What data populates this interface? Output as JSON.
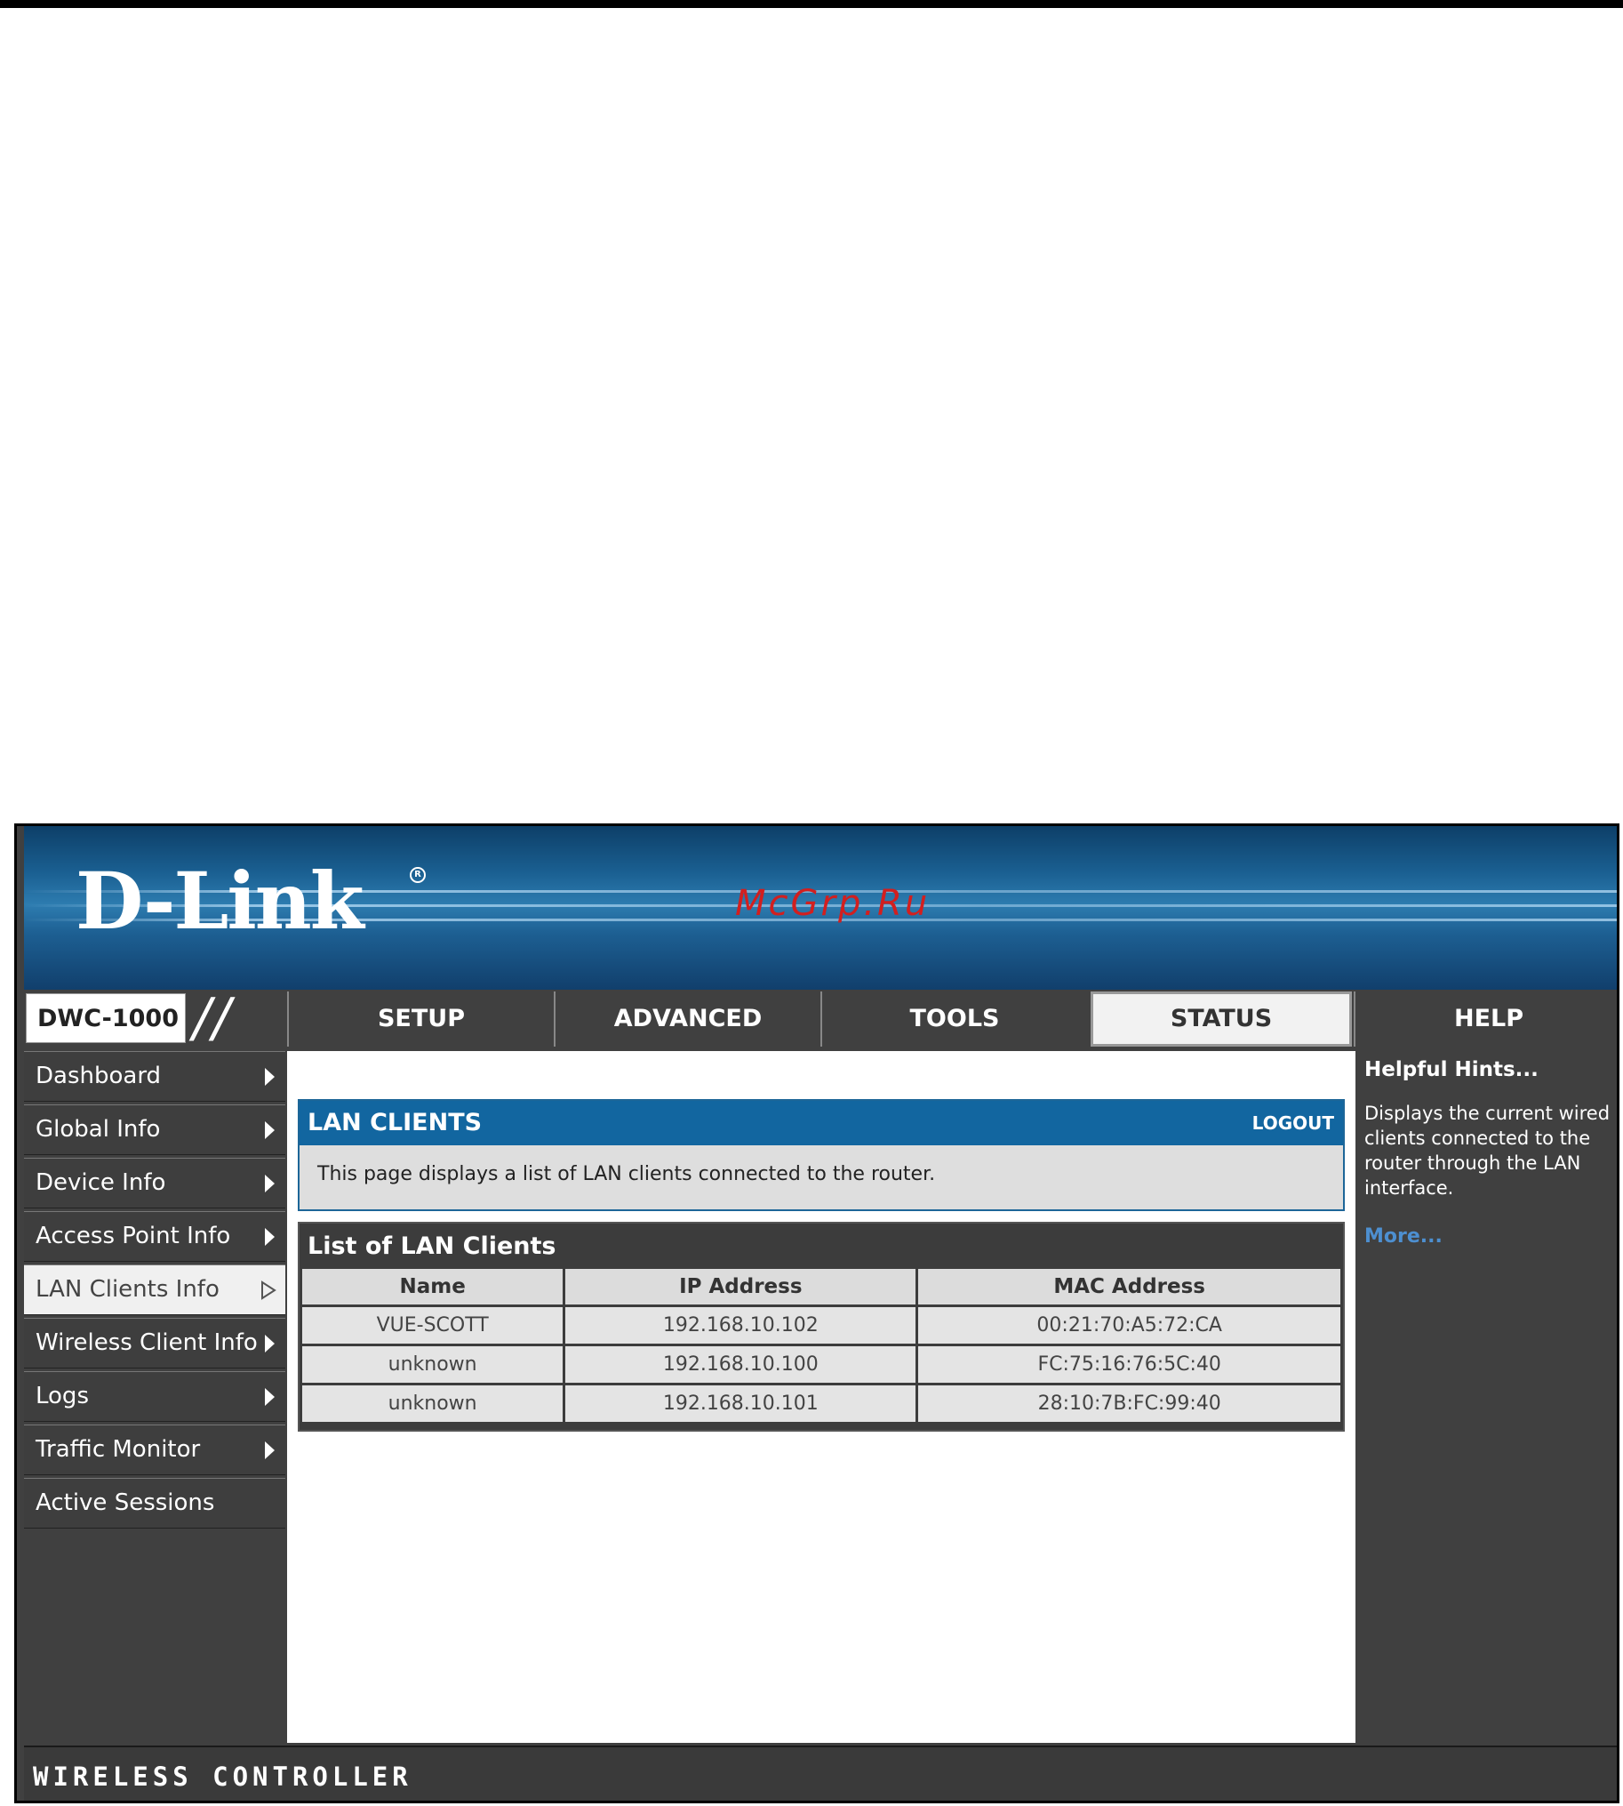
{
  "brand": {
    "logo": "D-Link",
    "watermark": "McGrp.Ru"
  },
  "nav": {
    "model": "DWC-1000",
    "tabs": [
      {
        "label": "SETUP"
      },
      {
        "label": "ADVANCED"
      },
      {
        "label": "TOOLS"
      },
      {
        "label": "STATUS",
        "active": true
      },
      {
        "label": "HELP"
      }
    ]
  },
  "sidebar": {
    "items": [
      {
        "label": "Dashboard"
      },
      {
        "label": "Global Info"
      },
      {
        "label": "Device Info"
      },
      {
        "label": "Access Point Info"
      },
      {
        "label": "LAN Clients Info",
        "active": true
      },
      {
        "label": "Wireless Client Info"
      },
      {
        "label": "Logs"
      },
      {
        "label": "Traffic Monitor"
      },
      {
        "label": "Active Sessions"
      }
    ]
  },
  "main": {
    "section_title": "LAN CLIENTS",
    "logout_label": "LOGOUT",
    "description": "This page displays a list of LAN clients connected to the router.",
    "list_title": "List of LAN Clients",
    "columns": [
      "Name",
      "IP Address",
      "MAC Address"
    ],
    "rows": [
      [
        "VUE-SCOTT",
        "192.168.10.102",
        "00:21:70:A5:72:CA"
      ],
      [
        "unknown",
        "192.168.10.100",
        "FC:75:16:76:5C:40"
      ],
      [
        "unknown",
        "192.168.10.101",
        "28:10:7B:FC:99:40"
      ]
    ]
  },
  "hints": {
    "title": "Helpful Hints...",
    "text": "Displays the current wired clients connected to the router through the LAN interface.",
    "more": "More..."
  },
  "footer": {
    "label": "WIRELESS CONTROLLER"
  },
  "colors": {
    "brand_blue": "#1266a0",
    "chrome_dark": "#404040",
    "link_blue": "#4d8fd0",
    "watermark_red": "#d21f1f"
  }
}
